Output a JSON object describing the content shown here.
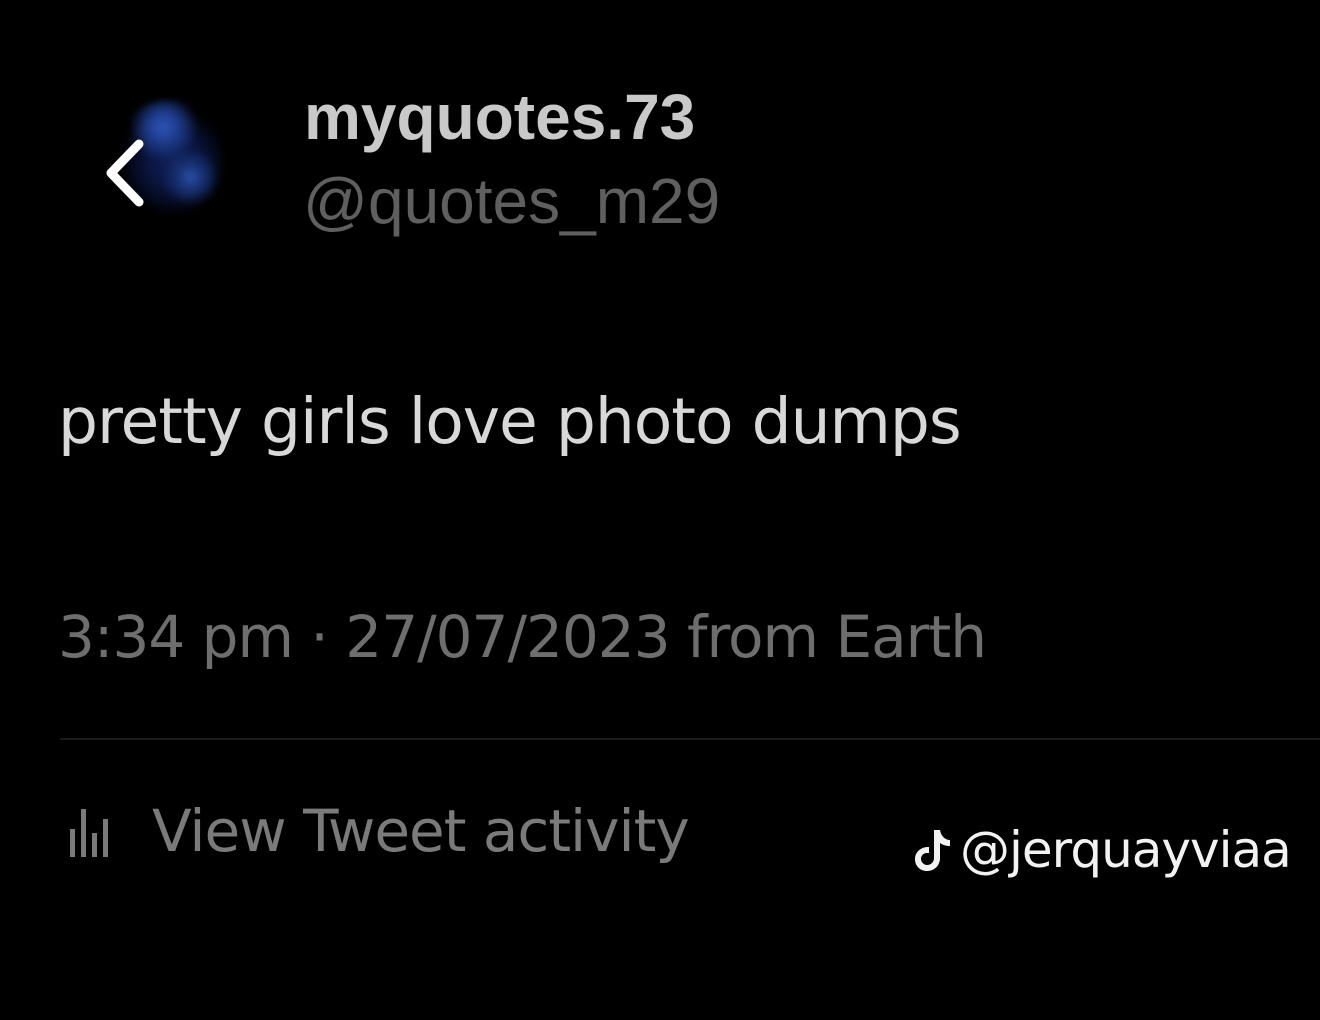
{
  "header": {
    "back_icon": "chevron-left-icon",
    "avatar_icon": "avatar-icon",
    "display_name": "myquotes.73",
    "handle": "@quotes_m29"
  },
  "tweet": {
    "text": "pretty girls love photo dumps",
    "meta": "3:34 pm · 27/07/2023 from Earth"
  },
  "activity": {
    "icon": "bar-chart-icon",
    "label": "View Tweet activity"
  },
  "watermark": {
    "icon": "tiktok-icon",
    "text": "@jerquayviaa"
  },
  "colors": {
    "background": "#000000",
    "name": "#c9c9c9",
    "handle": "#5f5f5f",
    "body_text": "#d8d8d8",
    "meta_text": "#6e6e6e"
  }
}
